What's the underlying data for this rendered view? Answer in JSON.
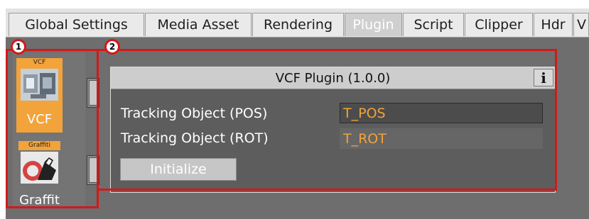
{
  "tabs": [
    {
      "label": "Global Settings",
      "active": false
    },
    {
      "label": "Media Asset",
      "active": false
    },
    {
      "label": "Rendering",
      "active": false
    },
    {
      "label": "Plugin",
      "active": true
    },
    {
      "label": "Script",
      "active": false
    },
    {
      "label": "Clipper",
      "active": false
    },
    {
      "label": "Hdr",
      "active": false
    },
    {
      "label": "V",
      "active": false
    }
  ],
  "annotations": {
    "marker_1": "1",
    "marker_2": "2"
  },
  "plugin_list": [
    {
      "badge": "VCF",
      "name": "VCF",
      "selected": true
    },
    {
      "badge": "Graffiti",
      "name": "Graffit",
      "selected": false
    }
  ],
  "plugin_panel": {
    "title": "VCF Plugin (1.0.0)",
    "info_label": "i",
    "fields": [
      {
        "label": "Tracking Object (POS)",
        "value": "T_POS"
      },
      {
        "label": "Tracking Object (ROT)",
        "value": "T_ROT"
      }
    ],
    "initialize_label": "Initialize"
  },
  "colors": {
    "accent": "#f2a33a",
    "annotation": "#d11a1a"
  }
}
